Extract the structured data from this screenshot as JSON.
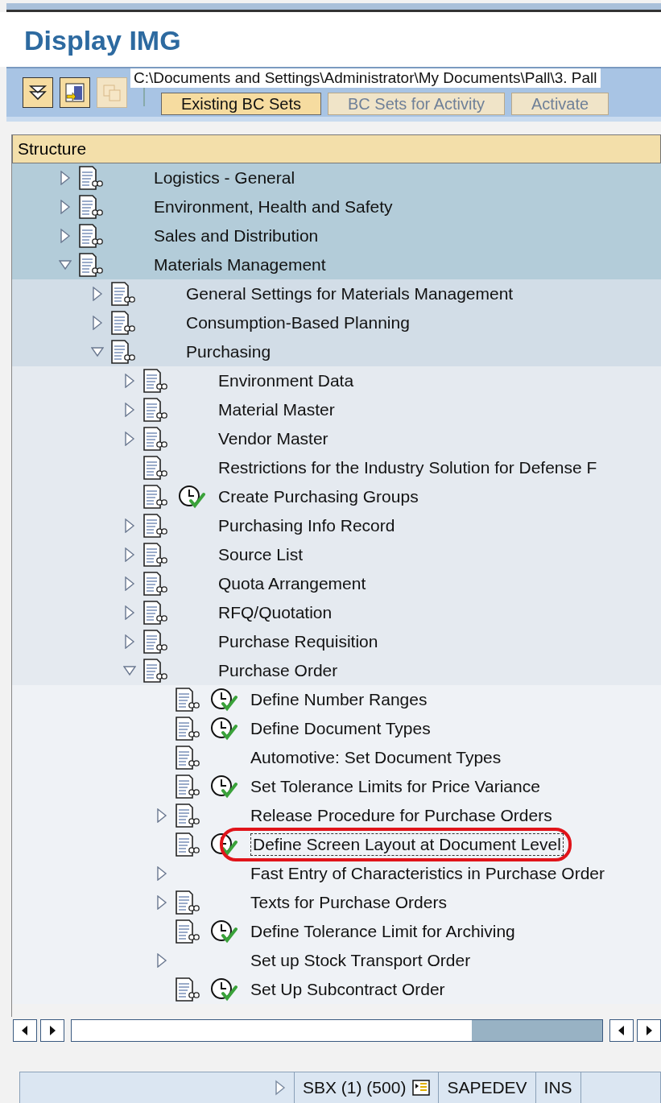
{
  "window": {
    "title": "Display IMG"
  },
  "toolbar": {
    "buttons": [
      {
        "label": "Existing BC Sets",
        "disabled": false
      },
      {
        "label": "BC Sets for Activity",
        "disabled": true
      },
      {
        "label": "Activate",
        "disabled": true
      }
    ],
    "tooltip": "C:\\Documents and Settings\\Administrator\\My Documents\\Pall\\3. Pall"
  },
  "tree": {
    "header": "Structure",
    "items": [
      {
        "label": "Logistics - General",
        "expanded": false,
        "document": true,
        "activity": false
      },
      {
        "label": "Environment, Health and Safety",
        "expanded": false,
        "document": true,
        "activity": false
      },
      {
        "label": "Sales and Distribution",
        "expanded": false,
        "document": true,
        "activity": false
      },
      {
        "label": "Materials Management",
        "expanded": true,
        "document": true,
        "activity": false,
        "children": [
          {
            "label": "General Settings for Materials Management",
            "expanded": false,
            "document": true,
            "activity": false
          },
          {
            "label": "Consumption-Based Planning",
            "expanded": false,
            "document": true,
            "activity": false
          },
          {
            "label": "Purchasing",
            "expanded": true,
            "document": true,
            "activity": false,
            "children": [
              {
                "label": "Environment Data",
                "expanded": false,
                "document": true,
                "activity": false
              },
              {
                "label": "Material Master",
                "expanded": false,
                "document": true,
                "activity": false
              },
              {
                "label": "Vendor Master",
                "expanded": false,
                "document": true,
                "activity": false
              },
              {
                "label": "Restrictions for the Industry Solution for Defense F",
                "document": true,
                "activity": false
              },
              {
                "label": "Create Purchasing Groups",
                "document": true,
                "activity": true
              },
              {
                "label": "Purchasing Info Record",
                "expanded": false,
                "document": true,
                "activity": false
              },
              {
                "label": "Source List",
                "expanded": false,
                "document": true,
                "activity": false
              },
              {
                "label": "Quota Arrangement",
                "expanded": false,
                "document": true,
                "activity": false
              },
              {
                "label": "RFQ/Quotation",
                "expanded": false,
                "document": true,
                "activity": false
              },
              {
                "label": "Purchase Requisition",
                "expanded": false,
                "document": true,
                "activity": false
              },
              {
                "label": "Purchase Order",
                "expanded": true,
                "document": true,
                "activity": false,
                "children": [
                  {
                    "label": "Define Number Ranges",
                    "document": true,
                    "activity": true
                  },
                  {
                    "label": "Define Document Types",
                    "document": true,
                    "activity": true
                  },
                  {
                    "label": "Automotive: Set Document Types",
                    "document": true,
                    "activity": false
                  },
                  {
                    "label": "Set Tolerance Limits for Price Variance",
                    "document": true,
                    "activity": true
                  },
                  {
                    "label": "Release Procedure for Purchase Orders",
                    "expanded": false,
                    "document": true,
                    "activity": false
                  },
                  {
                    "label": "Define Screen Layout at Document Level",
                    "document": true,
                    "activity": true,
                    "circled": true
                  },
                  {
                    "label": "Fast Entry of Characteristics in Purchase Order",
                    "expanded": false,
                    "document": false,
                    "activity": false
                  },
                  {
                    "label": "Texts for Purchase Orders",
                    "expanded": false,
                    "document": true,
                    "activity": false
                  },
                  {
                    "label": "Define Tolerance Limit for Archiving",
                    "document": true,
                    "activity": true
                  },
                  {
                    "label": "Set up Stock Transport Order",
                    "expanded": false,
                    "document": false,
                    "activity": false
                  },
                  {
                    "label": "Set Up Subcontract Order",
                    "document": true,
                    "activity": true
                  }
                ]
              }
            ]
          }
        ]
      }
    ]
  },
  "status_bar": {
    "system": "SBX (1) (500)",
    "server": "SAPEDEV",
    "mode": "INS"
  }
}
